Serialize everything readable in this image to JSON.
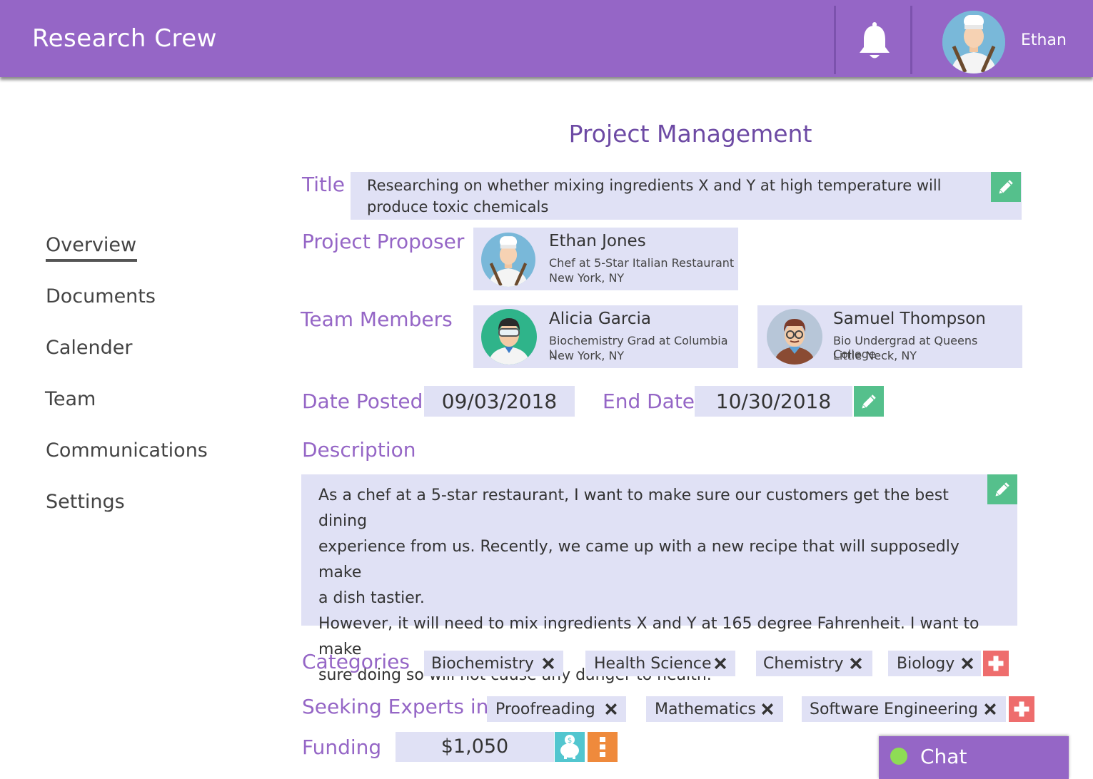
{
  "app": {
    "title": "Research Crew"
  },
  "header": {
    "user_name": "Ethan",
    "icons": [
      "bell-icon",
      "user-avatar"
    ]
  },
  "sidebar": {
    "items": [
      {
        "label": "Overview",
        "active": true
      },
      {
        "label": "Documents"
      },
      {
        "label": "Calender"
      },
      {
        "label": "Team"
      },
      {
        "label": "Communications"
      },
      {
        "label": "Settings"
      }
    ]
  },
  "main": {
    "page_title": "Project Management",
    "title_label": "Title",
    "title_value": "Researching on whether mixing ingredients X and Y at high temperature will produce toxic  chemicals",
    "proposer_label": "Project Proposer",
    "proposer": {
      "name": "Ethan Jones",
      "role": "Chef at 5-Star Italian Restaurant",
      "location": "New York, NY"
    },
    "team_label": "Team Members",
    "team": [
      {
        "name": "Alicia Garcia",
        "role": "Biochemistry Grad at Columbia U",
        "location": "New York, NY"
      },
      {
        "name": "Samuel Thompson",
        "role": "Bio Undergrad at Queens College",
        "location": "Little Neck, NY"
      }
    ],
    "date_posted_label": "Date Posted",
    "date_posted": "09/03/2018",
    "end_date_label": "End Date",
    "end_date": "10/30/2018",
    "description_label": "Description",
    "description_lines": [
      "As a chef at a 5-star restaurant, I want to make sure our customers get the best dining",
      "experience from us. Recently, we came up with a new recipe that will supposedly make",
      "a dish tastier.",
      "However, it will need to mix ingredients X and Y at 165 degree Fahrenheit. I want to make",
      "sure doing so will not cause any danger to health."
    ],
    "categories_label": "Categories",
    "categories": [
      "Biochemistry",
      "Health Science",
      "Chemistry",
      "Biology"
    ],
    "experts_label": "Seeking Experts in",
    "experts": [
      "Proofreading",
      "Mathematics",
      "Software Engineering"
    ],
    "funding_label": "Funding",
    "funding_value": "$1,050"
  },
  "chat": {
    "label": "Chat",
    "status_color": "#8edc55"
  },
  "colors": {
    "header": "#9566c6",
    "label": "#9566c6",
    "box": "#e0e1f5",
    "edit": "#55c08c",
    "add": "#ee6d6d",
    "funding_menu": "#ef8a3c",
    "piggy": "#52c6cf"
  }
}
